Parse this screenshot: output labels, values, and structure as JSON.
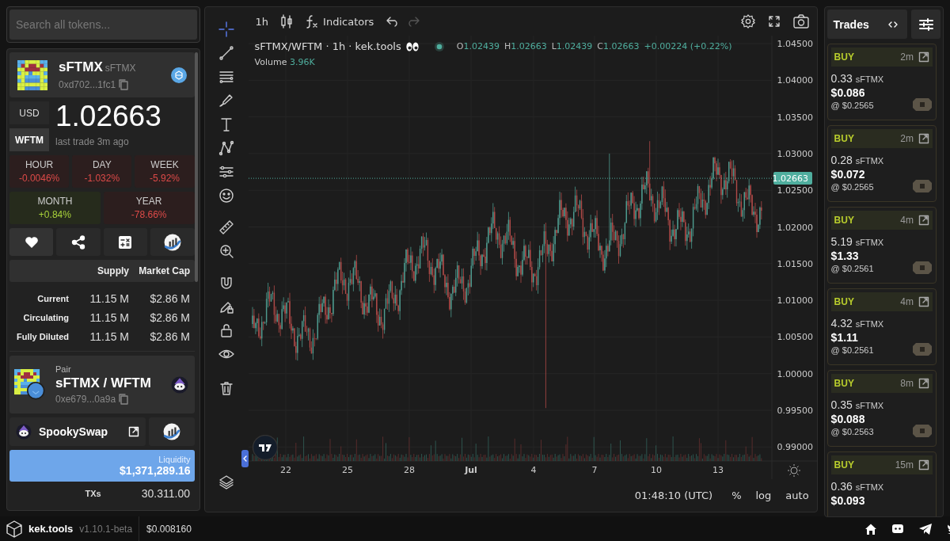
{
  "search": {
    "placeholder": "Search all tokens..."
  },
  "token": {
    "name": "sFTMX",
    "symbol": "sFTMX",
    "address": "0xd702...1fc1"
  },
  "price": {
    "currencies": [
      {
        "label": "USD",
        "selected": false
      },
      {
        "label": "WFTM",
        "selected": true
      }
    ],
    "value": "1.02663",
    "last_trade": "last trade 3m ago"
  },
  "changes": [
    {
      "label": "HOUR",
      "value": "-0.0046%",
      "positive": false
    },
    {
      "label": "DAY",
      "value": "-1.032%",
      "positive": false
    },
    {
      "label": "WEEK",
      "value": "-5.92%",
      "positive": false
    },
    {
      "label": "MONTH",
      "value": "+0.84%",
      "positive": true
    },
    {
      "label": "YEAR",
      "value": "-78.66%",
      "positive": false
    }
  ],
  "supply_table": {
    "columns": [
      "Supply",
      "Market Cap"
    ],
    "rows": [
      {
        "label": "Current",
        "supply": "11.15 M",
        "market_cap": "$2.86 M"
      },
      {
        "label": "Circulating",
        "supply": "11.15 M",
        "market_cap": "$2.86 M"
      },
      {
        "label": "Fully Diluted",
        "supply": "11.15 M",
        "market_cap": "$2.86 M"
      }
    ]
  },
  "pair": {
    "caption": "Pair",
    "name": "sFTMX / WFTM",
    "address": "0xe679...0a9a"
  },
  "dex": {
    "name": "SpookySwap"
  },
  "liquidity": {
    "label": "Liquidity",
    "value": "$1,371,289.16"
  },
  "txs": {
    "label": "TXs",
    "value": "30.311.00"
  },
  "chart": {
    "interval": "1h",
    "indicators": "Indicators",
    "legend_title": "sFTMX/WFTM · 1h · kek.tools",
    "ohlc": [
      {
        "label": "O",
        "value": "1.02439"
      },
      {
        "label": "H",
        "value": "1.02663"
      },
      {
        "label": "L",
        "value": "1.02439"
      },
      {
        "label": "C",
        "value": "1.02663"
      }
    ],
    "change": "+0.00224 (+0.22%)",
    "volume_label": "Volume",
    "volume": "3.96K",
    "price_axis": [
      "1.04500",
      "1.04000",
      "1.03500",
      "1.03000",
      "1.02500",
      "1.02000",
      "1.01500",
      "1.01000",
      "1.00500",
      "1.00000",
      "0.99500",
      "0.99000"
    ],
    "last_price": "1.02663",
    "time_axis": [
      "22",
      "25",
      "28",
      "Jul",
      "4",
      "7",
      "10",
      "13"
    ],
    "clock": "01:48:10 (UTC)",
    "scale_buttons": [
      "%",
      "log",
      "auto"
    ]
  },
  "trades": {
    "title": "Trades",
    "items": [
      {
        "side": "BUY",
        "age": "2m",
        "amount": "0.33",
        "token": "sFTMX",
        "usd": "$0.086",
        "price": "@ $0.2565"
      },
      {
        "side": "BUY",
        "age": "2m",
        "amount": "0.28",
        "token": "sFTMX",
        "usd": "$0.072",
        "price": "@ $0.2565"
      },
      {
        "side": "BUY",
        "age": "4m",
        "amount": "5.19",
        "token": "sFTMX",
        "usd": "$1.33",
        "price": "@ $0.2561"
      },
      {
        "side": "BUY",
        "age": "4m",
        "amount": "4.32",
        "token": "sFTMX",
        "usd": "$1.11",
        "price": "@ $0.2561"
      },
      {
        "side": "BUY",
        "age": "8m",
        "amount": "0.35",
        "token": "sFTMX",
        "usd": "$0.088",
        "price": "@ $0.2563"
      },
      {
        "side": "BUY",
        "age": "15m",
        "amount": "0.36",
        "token": "sFTMX",
        "usd": "$0.093"
      }
    ]
  },
  "footer": {
    "app": "kek.tools",
    "version": "v1.10.1-beta",
    "price": "$0.008160"
  }
}
